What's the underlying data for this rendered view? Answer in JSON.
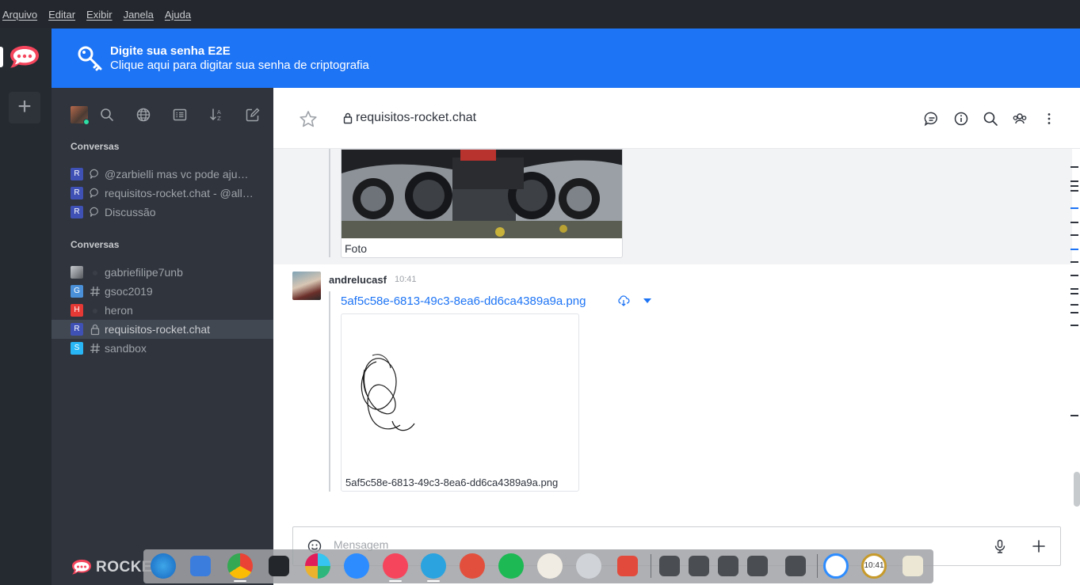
{
  "menubar": {
    "items": [
      "Arquivo",
      "Editar",
      "Exibir",
      "Janela",
      "Ajuda"
    ]
  },
  "banner": {
    "title": "Digite sua senha E2E",
    "subtitle": "Clique aqui para digitar sua senha de criptografia",
    "color": "#1d74f5"
  },
  "sidebar": {
    "section_discussions": "Conversas",
    "section_conversations": "Conversas",
    "discussions": [
      {
        "avatar_letter": "R",
        "name": "@zarbielli mas vc pode aju…",
        "avatar_color": "#3f51b5"
      },
      {
        "avatar_letter": "R",
        "name": "requisitos-rocket.chat - @all…",
        "avatar_color": "#3f51b5"
      },
      {
        "avatar_letter": "R",
        "name": "Discussão",
        "avatar_color": "#3f51b5"
      }
    ],
    "rooms": [
      {
        "avatar_letter": "",
        "name": "gabriefilipe7unb",
        "type": "direct",
        "avatar_color": "#8a8f94"
      },
      {
        "avatar_letter": "G",
        "name": "gsoc2019",
        "type": "channel",
        "avatar_color": "#4a90d9"
      },
      {
        "avatar_letter": "H",
        "name": "heron",
        "type": "direct",
        "avatar_color": "#e53935"
      },
      {
        "avatar_letter": "R",
        "name": "requisitos-rocket.chat",
        "type": "private",
        "avatar_color": "#3f51b5",
        "selected": true
      },
      {
        "avatar_letter": "S",
        "name": "sandbox",
        "type": "channel",
        "avatar_color": "#29b6f6"
      }
    ],
    "footer_logo_text": "ROCKET."
  },
  "header": {
    "room_title": "requisitos-rocket.chat"
  },
  "messages": {
    "previous": {
      "caption": "Foto"
    },
    "current": {
      "username": "andrelucasf",
      "time": "10:41",
      "file_name": "5af5c58e-6813-49c3-8ea6-dd6ca4389a9a.png",
      "attachment_caption": "5af5c58e-6813-49c3-8ea6-dd6ca4389a9a.png"
    }
  },
  "composer": {
    "placeholder": "Mensagem"
  },
  "dock": {
    "time_label": "10:41"
  }
}
